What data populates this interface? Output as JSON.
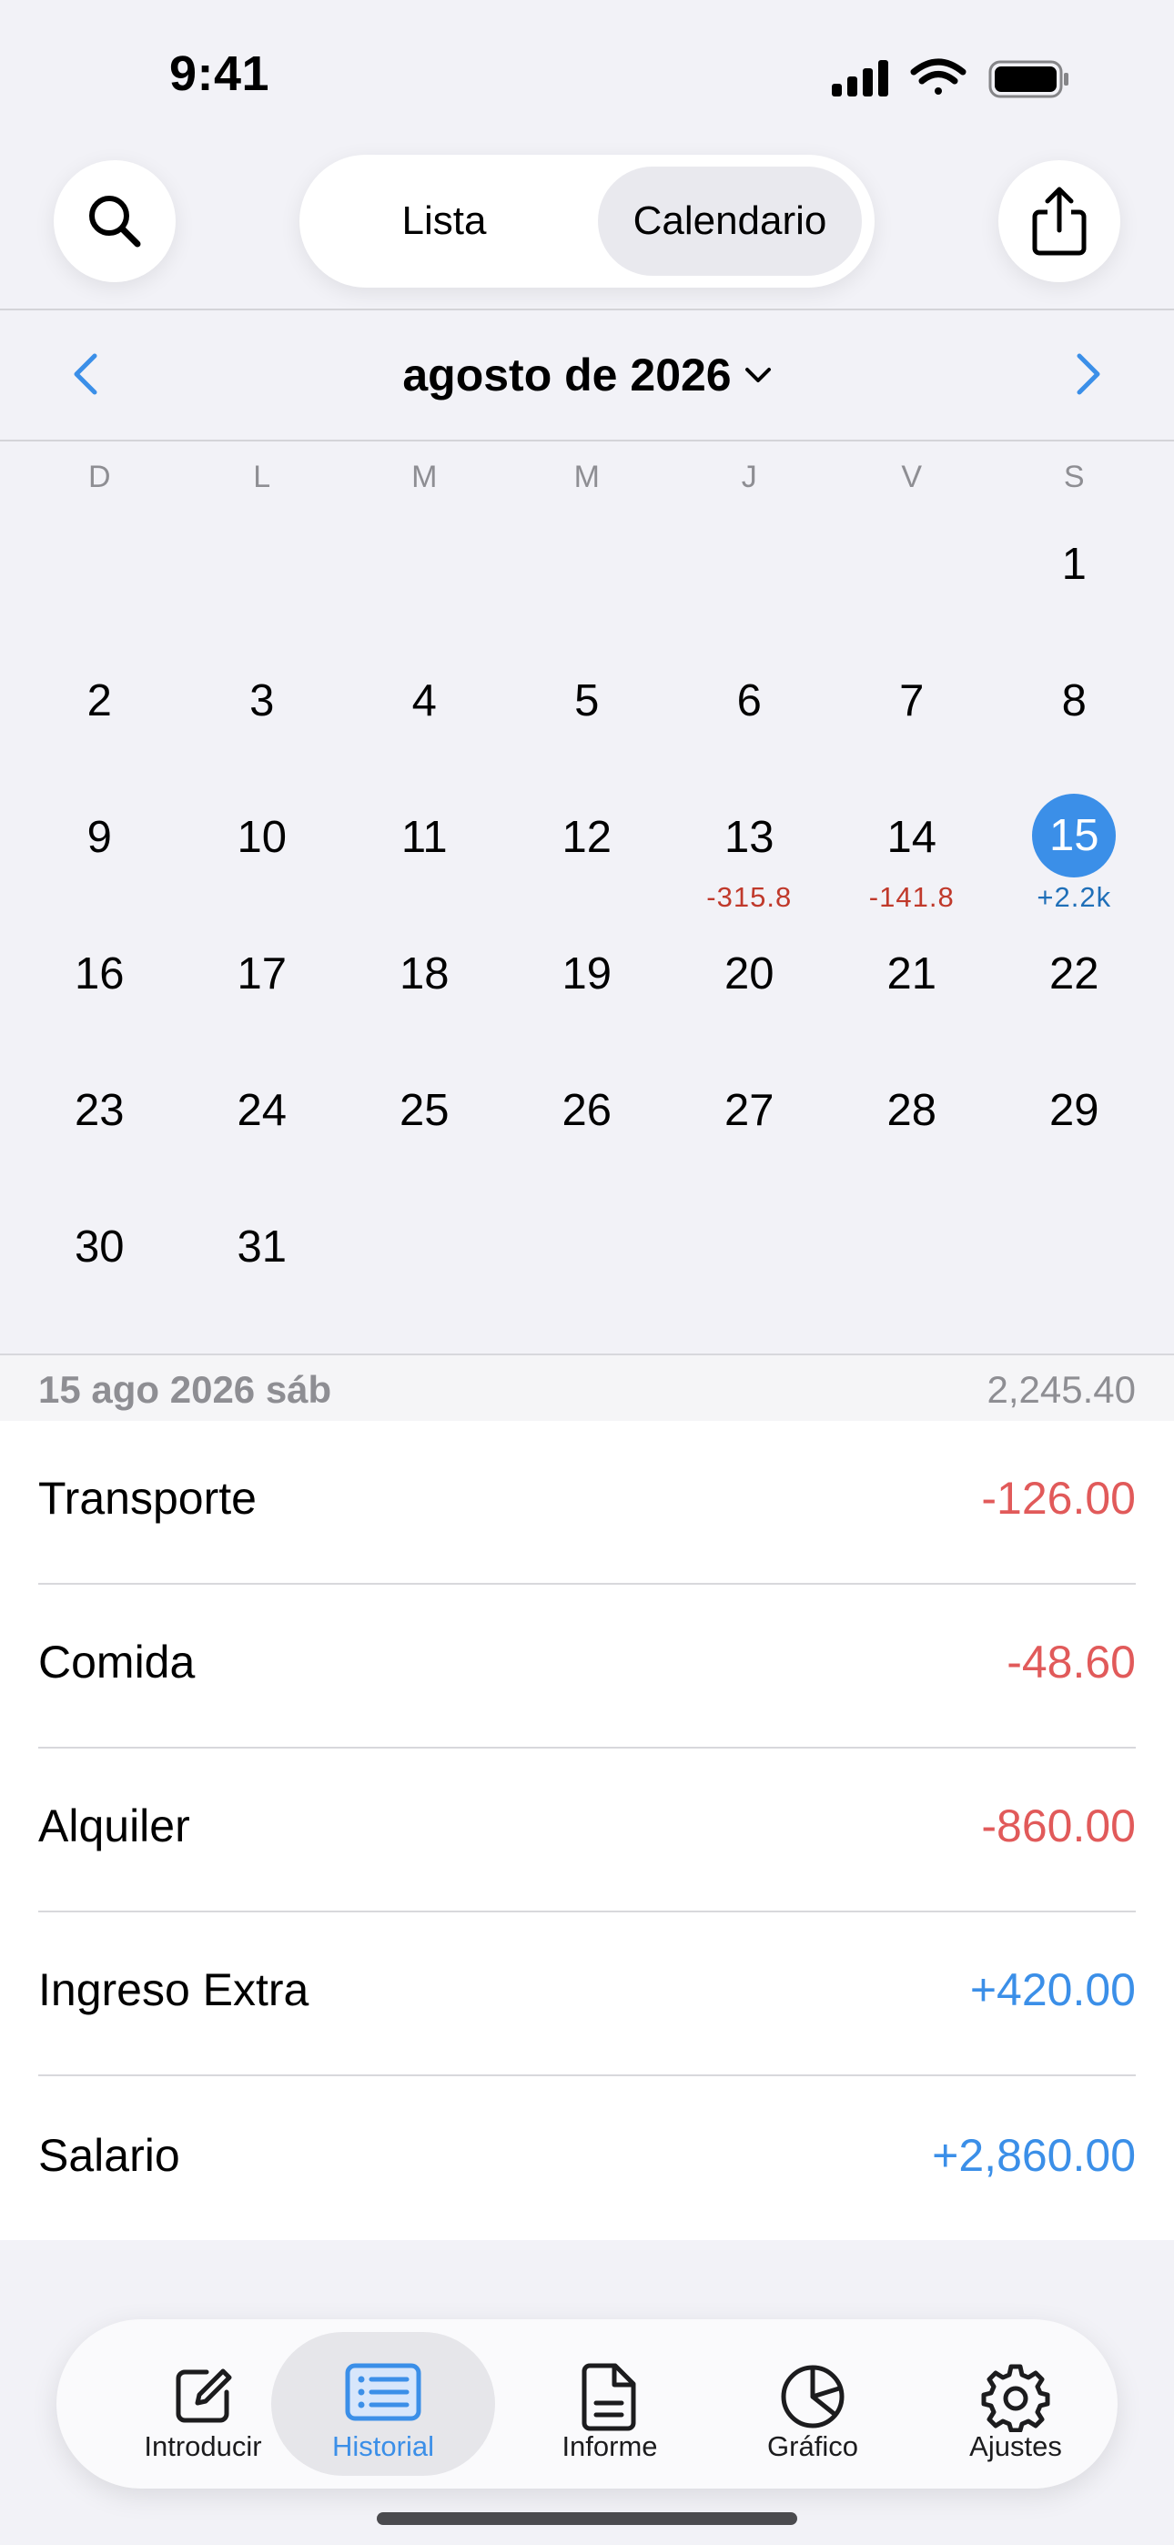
{
  "status_bar": {
    "time": "9:41"
  },
  "header": {
    "segments": [
      "Lista",
      "Calendario"
    ],
    "selected_segment": "Calendario"
  },
  "month": {
    "title": "agosto de 2026"
  },
  "weekdays": [
    "D",
    "L",
    "M",
    "M",
    "J",
    "V",
    "S"
  ],
  "calendar": {
    "weeks": [
      [
        {
          "d": ""
        },
        {
          "d": ""
        },
        {
          "d": ""
        },
        {
          "d": ""
        },
        {
          "d": ""
        },
        {
          "d": ""
        },
        {
          "d": "1"
        }
      ],
      [
        {
          "d": "2"
        },
        {
          "d": "3"
        },
        {
          "d": "4"
        },
        {
          "d": "5"
        },
        {
          "d": "6"
        },
        {
          "d": "7"
        },
        {
          "d": "8"
        }
      ],
      [
        {
          "d": "9"
        },
        {
          "d": "10"
        },
        {
          "d": "11"
        },
        {
          "d": "12"
        },
        {
          "d": "13",
          "amt": "-315.8",
          "kind": "neg"
        },
        {
          "d": "14",
          "amt": "-141.8",
          "kind": "neg"
        },
        {
          "d": "15",
          "amt": "+2.2k",
          "kind": "pos",
          "selected": true
        }
      ],
      [
        {
          "d": "16"
        },
        {
          "d": "17"
        },
        {
          "d": "18"
        },
        {
          "d": "19"
        },
        {
          "d": "20"
        },
        {
          "d": "21"
        },
        {
          "d": "22"
        }
      ],
      [
        {
          "d": "23"
        },
        {
          "d": "24"
        },
        {
          "d": "25"
        },
        {
          "d": "26"
        },
        {
          "d": "27"
        },
        {
          "d": "28"
        },
        {
          "d": "29"
        }
      ],
      [
        {
          "d": "30"
        },
        {
          "d": "31"
        },
        {
          "d": ""
        },
        {
          "d": ""
        },
        {
          "d": ""
        },
        {
          "d": ""
        },
        {
          "d": ""
        }
      ]
    ]
  },
  "day_summary": {
    "date": "15 ago 2026 sáb",
    "total": "2,245.40"
  },
  "transactions": [
    {
      "name": "Transporte",
      "amount": "-126.00",
      "kind": "neg"
    },
    {
      "name": "Comida",
      "amount": "-48.60",
      "kind": "neg"
    },
    {
      "name": "Alquiler",
      "amount": "-860.00",
      "kind": "neg"
    },
    {
      "name": "Ingreso Extra",
      "amount": "+420.00",
      "kind": "pos"
    },
    {
      "name": "Salario",
      "amount": "+2,860.00",
      "kind": "pos"
    }
  ],
  "tabs": [
    {
      "label": "Introducir",
      "icon": "compose-icon"
    },
    {
      "label": "Historial",
      "icon": "list-icon",
      "active": true
    },
    {
      "label": "Informe",
      "icon": "document-icon"
    },
    {
      "label": "Gráfico",
      "icon": "pie-chart-icon"
    },
    {
      "label": "Ajustes",
      "icon": "gear-icon"
    }
  ],
  "colors": {
    "accent": "#3b8fe8",
    "negative": "#e15a5a",
    "positive": "#3b8fe8",
    "calendar_negative": "#c0392b",
    "calendar_positive": "#1f6fb8"
  }
}
